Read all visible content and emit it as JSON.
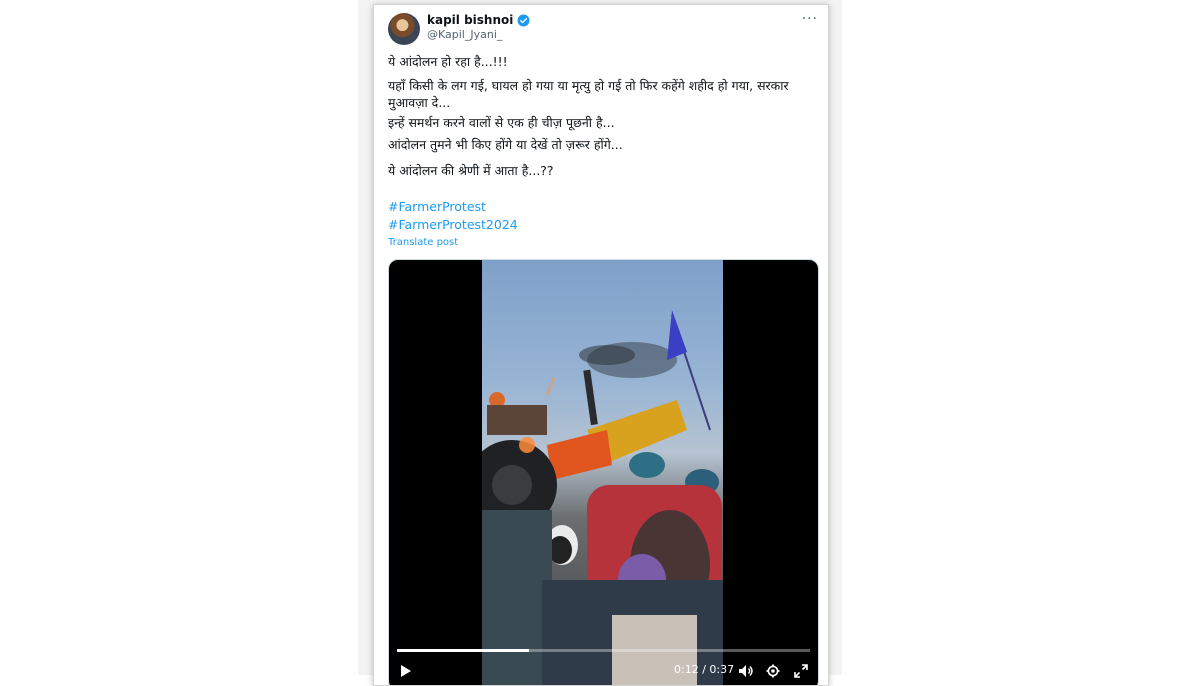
{
  "post": {
    "author_name": "kapil bishnoi",
    "author_handle": "@Kapil_Jyani_",
    "more_icon": "more-horizontal-icon",
    "lines": [
      "ये आंदोलन हो रहा है...!!!",
      "यहाँ किसी के लग गई, घायल हो गया या मृत्यु हो गई तो फिर कहेंगे शहीद हो गया, सरकार मुआवज़ा दे...",
      "इन्हें समर्थन करने वालों से एक ही चीज़ पूछनी है...",
      "आंदोलन तुमने भी किए होंगे या देखें तो ज़रूर होंगे...",
      "ये आंदोलन की श्रेणी में आता है...??"
    ],
    "hashtags": [
      "#FarmerProtest",
      "#FarmerProtest2024"
    ],
    "translate_label": "Translate post"
  },
  "video": {
    "current_time": "0:12",
    "duration": "0:37",
    "time_separator": "/",
    "progress_fraction": 0.32
  },
  "colors": {
    "link": "#1d9bf0",
    "text": "#0f1419",
    "muted": "#536471"
  }
}
